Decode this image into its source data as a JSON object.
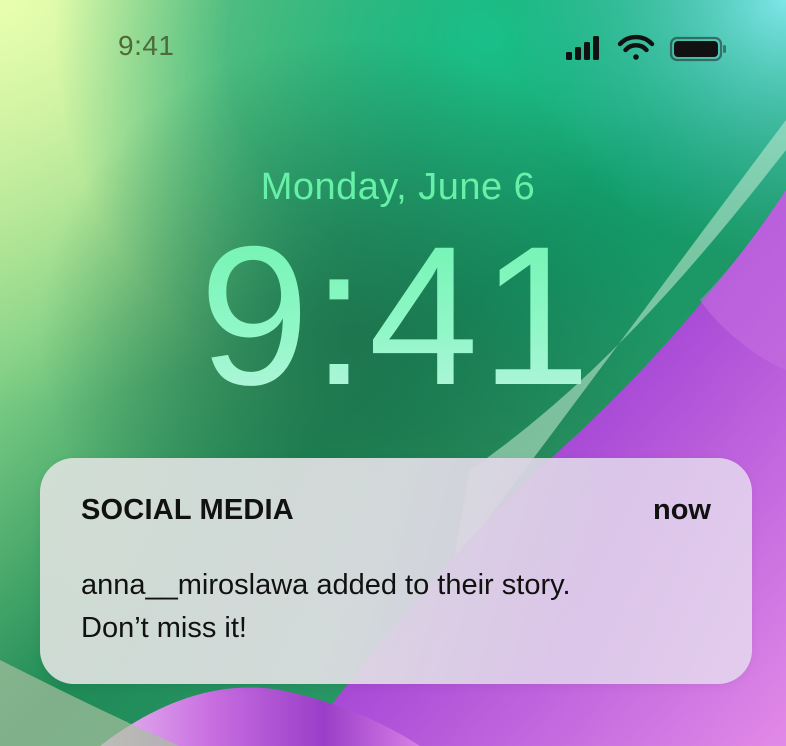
{
  "status_bar": {
    "time": "9:41",
    "icons": [
      "cellular-signal-icon",
      "wifi-icon",
      "battery-icon"
    ]
  },
  "lock_screen": {
    "date": "Monday, June 6",
    "time": "9:41"
  },
  "notification": {
    "app_name": "SOCIAL MEDIA",
    "timestamp": "now",
    "message_line1": "anna__miroslawa added to their story.",
    "message_line2": "Don’t miss it!"
  },
  "colors": {
    "date_text": "#66f0a8",
    "time_text": "#8ff7c6",
    "wallpaper_green": "#0e9a6a",
    "wallpaper_purple": "#9b3fd0"
  }
}
